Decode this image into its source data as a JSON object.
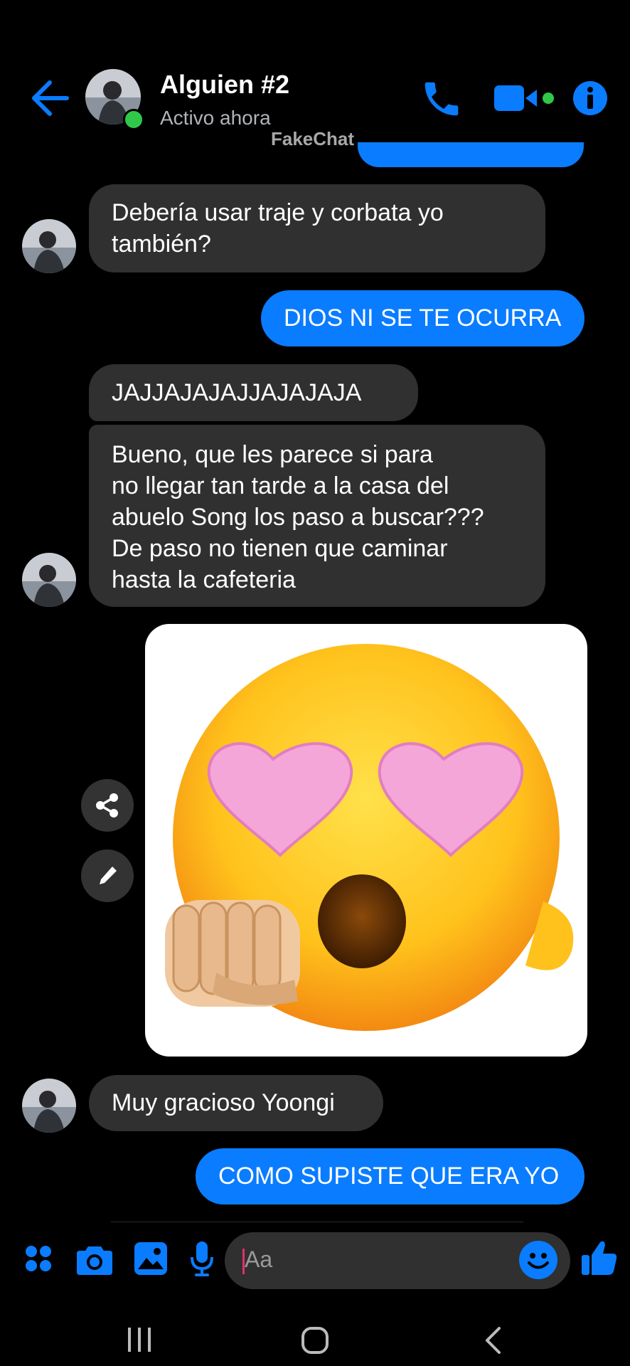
{
  "header": {
    "contact_name": "Alguien #2",
    "status": "Activo ahora",
    "watermark": "FakeChat"
  },
  "messages": [
    {
      "side": "in",
      "text": "Debería usar traje y corbata yo\ntambién?"
    },
    {
      "side": "out",
      "text": "DIOS NI SE TE OCURRA"
    },
    {
      "side": "in",
      "text": "JAJJAJAJAJJAJAJAJA"
    },
    {
      "side": "in",
      "text": "Bueno, que les parece si para\nno llegar tan tarde a la casa del\nabuelo Song los paso a buscar???\nDe paso no tienen que caminar\nhasta la cafeteria"
    },
    {
      "side": "out",
      "type": "image",
      "content": "heart-eyes-emoji-with-fist"
    },
    {
      "side": "in",
      "text": "Muy gracioso Yoongi"
    },
    {
      "side": "out",
      "text": "COMO SUPISTE QUE ERA YO"
    }
  ],
  "composer": {
    "placeholder": "Aa",
    "icons": [
      "apps-icon",
      "camera-icon",
      "gallery-icon",
      "microphone-icon",
      "emoji-icon",
      "like-icon"
    ]
  },
  "colors": {
    "accent": "#0a7cff",
    "incoming_bubble": "#303030",
    "online": "#31c84a"
  }
}
